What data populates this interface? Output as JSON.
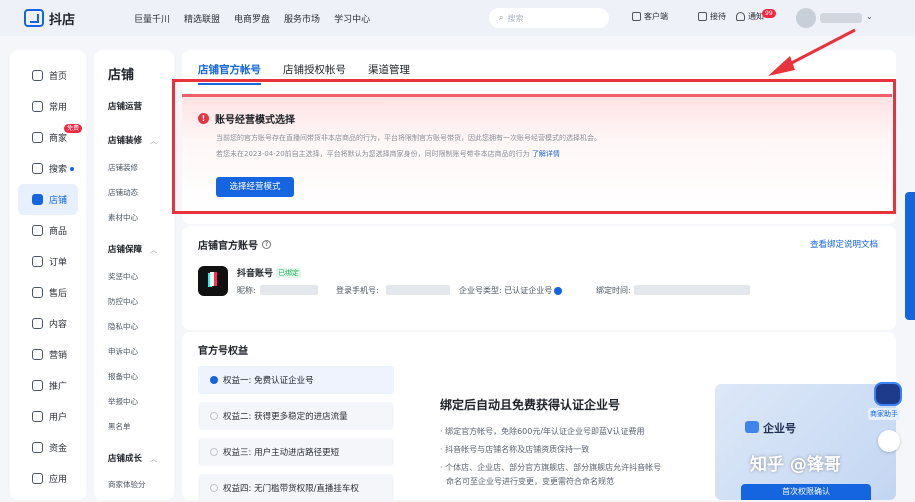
{
  "topbar": {
    "brand": "抖店",
    "nav": [
      "巨量千川",
      "精选联盟",
      "电商罗盘",
      "服务市场",
      "学习中心"
    ],
    "search_placeholder": "搜索",
    "client": "客户端",
    "recruit": "接待",
    "notify": "通知",
    "notify_count": "99"
  },
  "leftnav": [
    {
      "label": "首页",
      "icon": "home-icon"
    },
    {
      "label": "常用",
      "icon": "star-icon"
    },
    {
      "label": "商家",
      "icon": "shop-icon",
      "badge": "免费"
    },
    {
      "label": "搜索",
      "icon": "search-icon",
      "dot": true
    },
    {
      "label": "店铺",
      "icon": "store-icon",
      "active": true
    },
    {
      "label": "商品",
      "icon": "goods-icon"
    },
    {
      "label": "订单",
      "icon": "order-icon"
    },
    {
      "label": "售后",
      "icon": "aftersale-icon"
    },
    {
      "label": "内容",
      "icon": "content-icon"
    },
    {
      "label": "营销",
      "icon": "marketing-icon"
    },
    {
      "label": "推广",
      "icon": "promote-icon"
    },
    {
      "label": "用户",
      "icon": "user-icon"
    },
    {
      "label": "资金",
      "icon": "money-icon"
    },
    {
      "label": "应用",
      "icon": "app-icon"
    }
  ],
  "subnav": {
    "title": "店铺",
    "groups": [
      {
        "label": "店铺运营",
        "items": []
      },
      {
        "label": "店铺装修",
        "items": [
          "店铺装修",
          "店铺动态",
          "素材中心"
        ]
      },
      {
        "label": "店铺保障",
        "items": [
          "奖惩中心",
          "防控中心",
          "隐私中心",
          "申诉中心",
          "报备中心",
          "举报中心",
          "黑名单"
        ]
      },
      {
        "label": "店铺成长",
        "items": [
          "商家体验分"
        ]
      }
    ]
  },
  "tabs": [
    "店铺官方帐号",
    "店铺授权帐号",
    "渠道管理"
  ],
  "alert": {
    "title": "账号经营模式选择",
    "line1": "当前您的官方账号存在直播间带货非本店商品的行为，平台将限制官方账号带货，因此您拥有一次账号经营模式的选择机会。",
    "line2": "若您未在2023-04-20前自主选择，平台将默认为您选择商家身份，同时限制账号带非本店商品的行为",
    "link": "了解详情",
    "button": "选择经营模式"
  },
  "official": {
    "heading": "店铺官方账号",
    "help": "?",
    "doc_link": "查看绑定说明文档",
    "name": "抖音账号",
    "bound": "已绑定",
    "nick_label": "昵称:",
    "phone_label": "登录手机号:",
    "type_label": "企业号类型: 已认证企业号",
    "time_label": "绑定时间:"
  },
  "rights": {
    "heading": "官方号权益",
    "items": [
      "权益一: 免费认证企业号",
      "权益二: 获得更多稳定的进店流量",
      "权益三: 用户主动进店路径更短",
      "权益四: 无门槛带货权限/直播挂车权"
    ],
    "title": "绑定后自动且免费获得认证企业号",
    "bullets": [
      "· 绑定官方帐号，免除600元/年认证企业号即蓝V认证费用",
      "· 抖音帐号与店铺名称及店铺资质保持一致",
      "· 个体店、企业店、部分官方旗舰店、部分旗舰店允许抖音帐号",
      "命名可至企业号进行变更，变更需符合命名规范"
    ],
    "promo": "企业号",
    "promo_btn": "首次权限确认"
  },
  "helper": "商家助手",
  "watermark": "知乎 @锋哥",
  "colors": {
    "accent": "#1565e0",
    "alert": "#e8323c"
  }
}
